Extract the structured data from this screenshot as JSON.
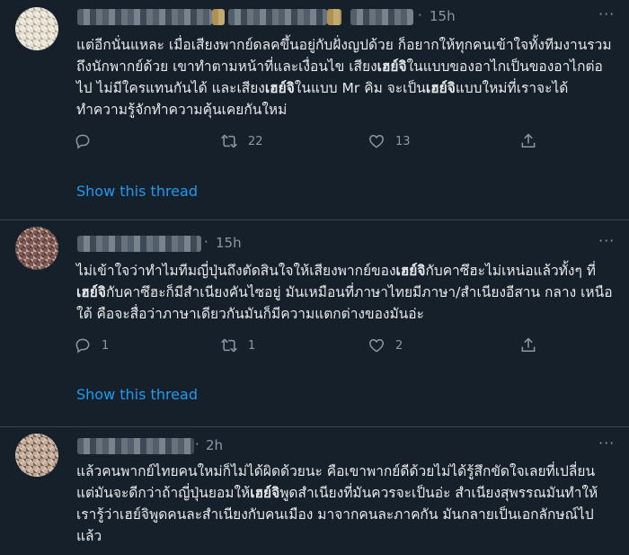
{
  "tweets": [
    {
      "time": "15h",
      "text_parts": [
        {
          "t": "แต่อีกนั่นแหละ เมื่อเสียงพากย์ดลคขึ้นอยู่กับฝั่งญปด้วย ก็อยากให้ทุกคนเข้าใจทั้งทีมงานรวมถึงนักพากย์ด้วย เขาทำตามหน้าที่และเงื่อนไข เสียง"
        },
        {
          "t": "เฮย์จิ",
          "b": true
        },
        {
          "t": "ในแบบของอาไกเป็นของอาไกต่อไป ไม่มีใครแทนกันได้ และเสียง"
        },
        {
          "t": "เฮย์จิ",
          "b": true
        },
        {
          "t": "ในแบบ Mr คิม จะเป็น"
        },
        {
          "t": "เฮย์จิ",
          "b": true
        },
        {
          "t": "แบบใหม่ที่เราจะได้ทำความรู้จักทำความคุ้นเคยกันใหม่"
        }
      ],
      "reply_count": "",
      "retweet_count": "22",
      "like_count": "13",
      "show_thread": "Show this thread"
    },
    {
      "time": "15h",
      "text_parts": [
        {
          "t": "ไม่เข้าใจว่าทำไมทีมญี่ปุ่นถึงตัดสินใจให้เสียงพากย์ของ"
        },
        {
          "t": "เฮย์จิ",
          "b": true
        },
        {
          "t": "กับคาซึฮะไม่เหน่อแล้วทั้งๆ ที่"
        },
        {
          "t": "เฮย์จิ",
          "b": true
        },
        {
          "t": "กับคาซึฮะก็มีสำเนียงคันไซอยู่ มันเหมือนที่ภาษาไทยมีภาษา/สำเนียงอีสาน กลาง เหนือ ใต้ คือจะสื่อว่าภาษาเดียวกันมันก็มีความแตกต่างของมันอ่ะ"
        }
      ],
      "reply_count": "1",
      "retweet_count": "1",
      "like_count": "2",
      "show_thread": "Show this thread"
    },
    {
      "time": "2h",
      "text_parts": [
        {
          "t": "แล้วคนพากย์ไทยคนใหม่ก็ไม่ได้ผิดด้วยนะ คือเขาพากย์ดีด้วยไม่ได้รู้สึกขัดใจเลยที่เปลี่ยน แต่มันจะดีกว่าถ้าญี่ปุ่นยอมให้"
        },
        {
          "t": "เฮย์จิ",
          "b": true
        },
        {
          "t": "พูดสำเนียงที่มันควรจะเป็นอ่ะ สำเนียงสุพรรณมันทำให้เรารู้ว่าเฮย์จิพูดคนละสำเนียงกับคนเมือง มาจากคนละภาคกัน มันกลายเป็นเอกลักษณ์ไปแล้ว"
        }
      ]
    }
  ],
  "icons": {
    "reply": "reply-icon",
    "retweet": "retweet-icon",
    "like": "heart-icon",
    "share": "share-icon",
    "more": "more-icon"
  },
  "colors": {
    "background": "#15202b",
    "text": "#e7e9ea",
    "muted": "#8b98a5",
    "link": "#1d9bf0",
    "divider": "#38444d"
  }
}
